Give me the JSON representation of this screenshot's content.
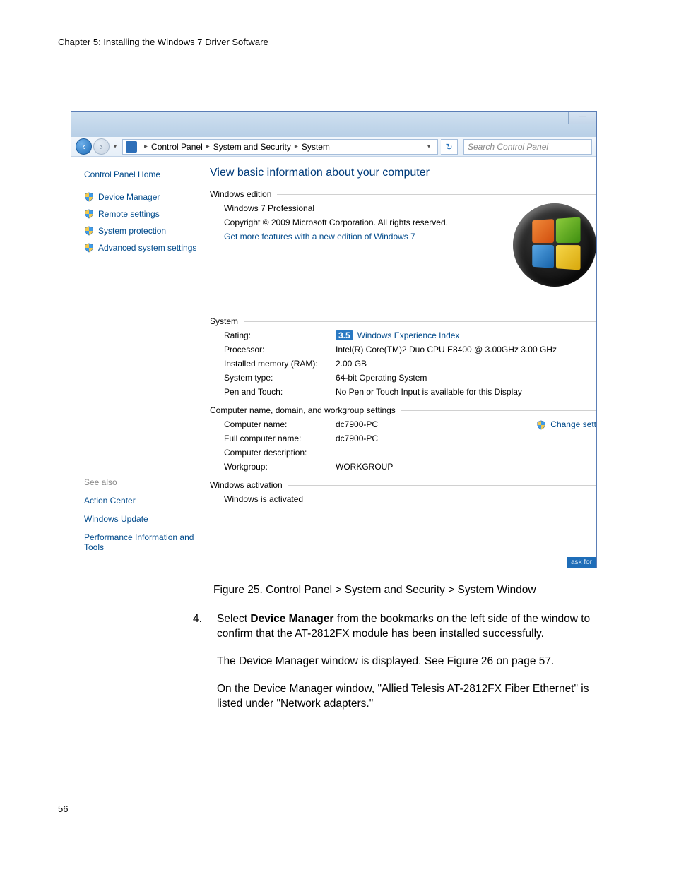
{
  "doc": {
    "chapter_header": "Chapter 5: Installing the Windows 7 Driver Software",
    "page_number": "56",
    "caption": "Figure 25. Control Panel > System and Security > System Window",
    "step_no": "4.",
    "step4_a": "Select ",
    "step4_bold": "Device Manager",
    "step4_b": " from the bookmarks on the left side of the window to confirm that the AT-2812FX module has been installed successfully.",
    "para2": "The Device Manager window is displayed. See Figure 26 on page 57.",
    "para3": "On the Device Manager window, \"Allied Telesis AT-2812FX Fiber Ethernet\" is listed under \"Network adapters.\""
  },
  "window": {
    "win_btn": "—",
    "breadcrumb": {
      "seg1": "Control Panel",
      "seg2": "System and Security",
      "seg3": "System"
    },
    "search_placeholder": "Search Control Panel",
    "sidebar": {
      "home": "Control Panel Home",
      "items": [
        {
          "label": "Device Manager"
        },
        {
          "label": "Remote settings"
        },
        {
          "label": "System protection"
        },
        {
          "label": "Advanced system settings"
        }
      ],
      "see_also_title": "See also",
      "see_also": [
        {
          "label": "Action Center"
        },
        {
          "label": "Windows Update"
        },
        {
          "label": "Performance Information and Tools"
        }
      ]
    },
    "main": {
      "title": "View basic information about your computer",
      "edition_section": "Windows edition",
      "edition_name": "Windows 7 Professional",
      "copyright": "Copyright © 2009 Microsoft Corporation.  All rights reserved.",
      "get_more": "Get more features with a new edition of Windows 7",
      "system_section": "System",
      "rating_label": "Rating:",
      "rating_value": "3.5",
      "wei": "Windows Experience Index",
      "proc_label": "Processor:",
      "proc_value": "Intel(R) Core(TM)2 Duo CPU    E8400  @ 3.00GHz  3.00 GHz",
      "ram_label": "Installed memory (RAM):",
      "ram_value": "2.00 GB",
      "type_label": "System type:",
      "type_value": "64-bit Operating System",
      "pen_label": "Pen and Touch:",
      "pen_value": "No Pen or Touch Input is available for this Display",
      "name_section": "Computer name, domain, and workgroup settings",
      "cname_label": "Computer name:",
      "cname_value": "dc7900-PC",
      "fcname_label": "Full computer name:",
      "fcname_value": "dc7900-PC",
      "cdesc_label": "Computer description:",
      "cdesc_value": "",
      "wg_label": "Workgroup:",
      "wg_value": "WORKGROUP",
      "change": "Change sett",
      "activation_section": "Windows activation",
      "activation_status": "Windows is activated",
      "ask_for": "ask for"
    }
  }
}
